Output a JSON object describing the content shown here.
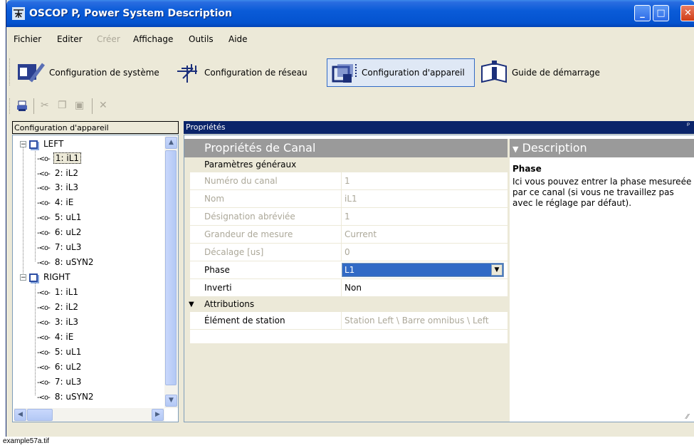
{
  "window": {
    "title": "OSCOP P, Power System Description",
    "controls": [
      "minimize",
      "maximize",
      "close"
    ]
  },
  "menu": [
    "Fichier",
    "Editer",
    "Créer",
    "Affichage",
    "Outils",
    "Aide"
  ],
  "menu_disabled": [
    "Créer"
  ],
  "big_toolbar": [
    {
      "label": "Configuration de système",
      "icon": "system-config-icon"
    },
    {
      "label": "Configuration de réseau",
      "icon": "network-config-icon"
    },
    {
      "label": "Configuration d'appareil",
      "icon": "device-config-icon",
      "active": true
    },
    {
      "label": "Guide de démarrage",
      "icon": "info-icon"
    }
  ],
  "small_toolbar": [
    "print-icon",
    "cut-icon",
    "copy-icon",
    "paste-icon",
    "delete-icon"
  ],
  "left_panel": {
    "header": "Configuration d'appareil",
    "tree": [
      {
        "device": "LEFT",
        "channels": [
          "1: iL1",
          "2: iL2",
          "3: iL3",
          "4: iE",
          "5: uL1",
          "6: uL2",
          "7: uL3",
          "8: uSYN2"
        ]
      },
      {
        "device": "RIGHT",
        "channels": [
          "1: iL1",
          "2: iL2",
          "3: iL3",
          "4: iE",
          "5: uL1",
          "6: uL2",
          "7: uL3",
          "8: uSYN2"
        ]
      }
    ],
    "selected": "LEFT / 1: iL1"
  },
  "properties": {
    "header": "Propriétés",
    "grid_title": "Propriétés de Canal",
    "general_category": "Paramètres généraux",
    "rows": [
      {
        "name": "Numéro du canal",
        "value": "1",
        "readonly": true
      },
      {
        "name": "Nom",
        "value": "iL1",
        "readonly": true
      },
      {
        "name": "Désignation abréviée",
        "value": "1",
        "readonly": true
      },
      {
        "name": "Grandeur de mesure",
        "value": "Current",
        "readonly": true
      },
      {
        "name": "Décalage [us]",
        "value": "0",
        "readonly": true
      },
      {
        "name": "Phase",
        "value": "L1",
        "readonly": false,
        "editor": "dropdown"
      },
      {
        "name": "Inverti",
        "value": "Non",
        "readonly": false
      }
    ],
    "attrib_category": "Attributions",
    "attrib_rows": [
      {
        "name": "Élément de station",
        "value": "Station Left \\ Barre omnibus \\ Left",
        "readonly": true
      }
    ]
  },
  "description": {
    "header": "Description",
    "title": "Phase",
    "body": "Ici vous pouvez entrer la phase mesureée par ce canal (si vous ne travaillez pas avec le réglage par défaut)."
  },
  "caption": "example57a.tif",
  "colors": {
    "titlebar": "#0453cf",
    "selection": "#316ac5",
    "panel_header": "#9a9a9a",
    "face": "#ece9d8"
  }
}
